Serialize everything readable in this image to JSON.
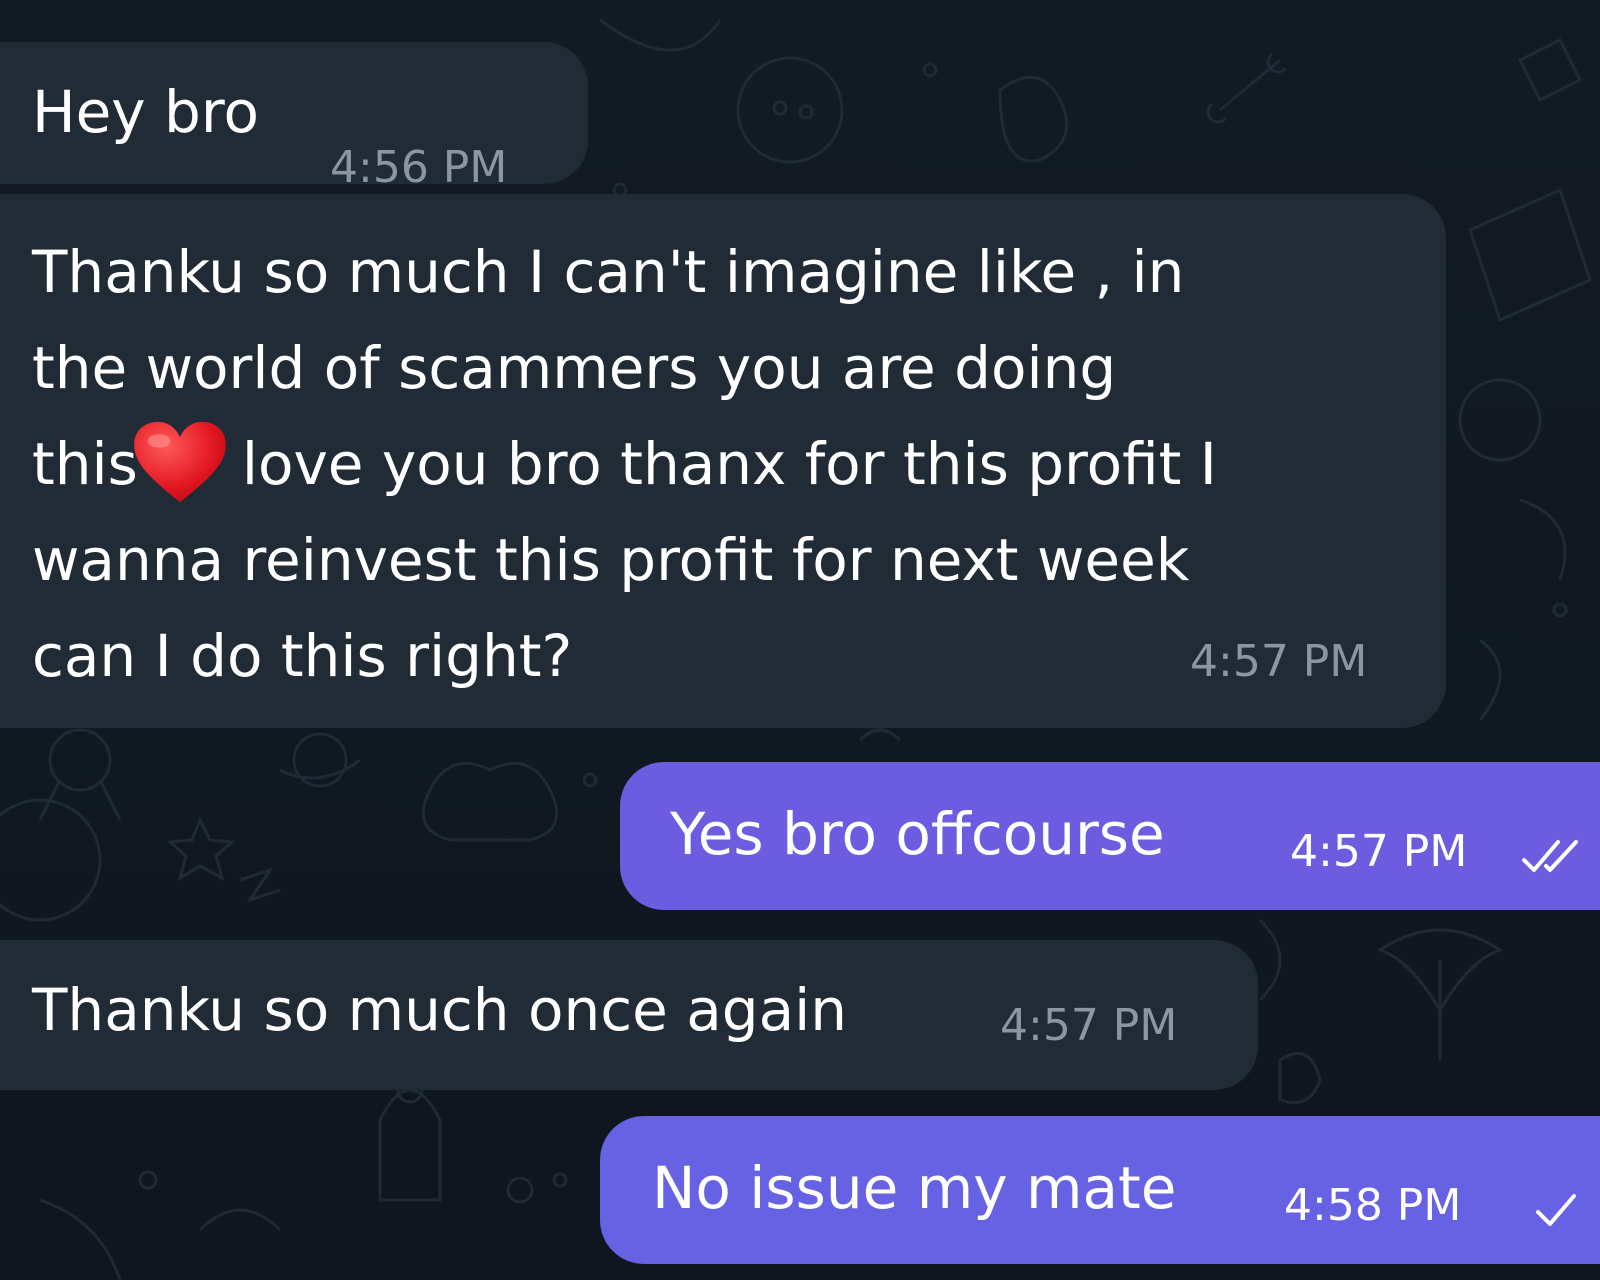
{
  "chat": {
    "messages": [
      {
        "direction": "incoming",
        "text": "Hey bro",
        "time": "4:56 PM"
      },
      {
        "direction": "incoming",
        "lines": [
          "Thanku so much I can't imagine like , in",
          "the world of scammers you are doing",
          "this",
          "love you bro thanx for this profit I",
          "wanna reinvest this profit for next week",
          "can I do this right?"
        ],
        "emoji": "red-heart",
        "time": "4:57 PM"
      },
      {
        "direction": "outgoing",
        "text": "Yes bro offcourse",
        "time": "4:57 PM",
        "status": "read",
        "status_icon": "double-check-icon"
      },
      {
        "direction": "incoming",
        "text": "Thanku so much once again",
        "time": "4:57 PM"
      },
      {
        "direction": "outgoing",
        "text": "No issue my mate",
        "time": "4:58 PM",
        "status": "sent",
        "status_icon": "single-check-icon"
      }
    ]
  },
  "colors": {
    "background": "#111822",
    "incoming_bubble": "#212b36",
    "outgoing_bubble": "#6c5ce0",
    "incoming_time": "#8b96a3",
    "text": "#ffffff"
  }
}
